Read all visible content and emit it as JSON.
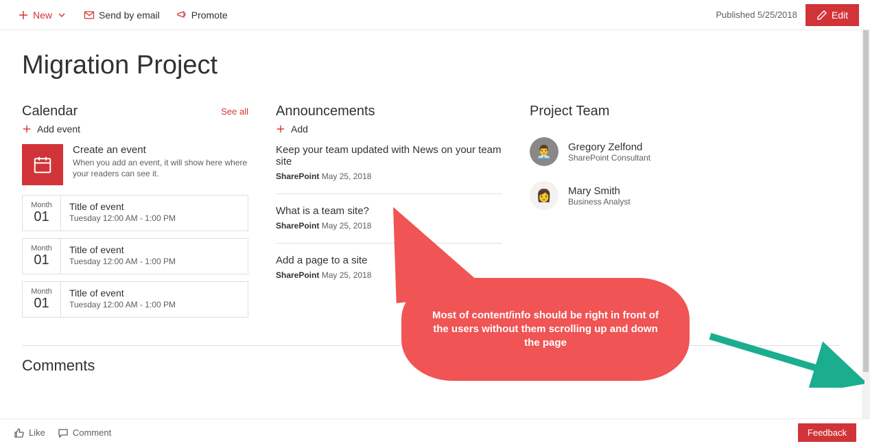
{
  "toolbar": {
    "new_label": "New",
    "send_label": "Send by email",
    "promote_label": "Promote",
    "published_label": "Published 5/25/2018",
    "edit_label": "Edit"
  },
  "page": {
    "title": "Migration Project"
  },
  "calendar": {
    "heading": "Calendar",
    "see_all": "See all",
    "add_label": "Add event",
    "hero_title": "Create an event",
    "hero_sub": "When you add an event, it will show here where your readers can see it.",
    "events": [
      {
        "month": "Month",
        "day": "01",
        "title": "Title of event",
        "time": "Tuesday 12:00 AM - 1:00 PM"
      },
      {
        "month": "Month",
        "day": "01",
        "title": "Title of event",
        "time": "Tuesday 12:00 AM - 1:00 PM"
      },
      {
        "month": "Month",
        "day": "01",
        "title": "Title of event",
        "time": "Tuesday 12:00 AM - 1:00 PM"
      }
    ]
  },
  "announcements": {
    "heading": "Announcements",
    "add_label": "Add",
    "items": [
      {
        "title": "Keep your team updated with News on your team site",
        "source": "SharePoint",
        "date": "May 25, 2018"
      },
      {
        "title": "What is a team site?",
        "source": "SharePoint",
        "date": "May 25, 2018"
      },
      {
        "title": "Add a page to a site",
        "source": "SharePoint",
        "date": "May 25, 2018"
      }
    ]
  },
  "team": {
    "heading": "Project Team",
    "members": [
      {
        "name": "Gregory Zelfond",
        "role": "SharePoint Consultant",
        "avatar_bg": "#8a8886",
        "avatar_emoji": "👨‍💼"
      },
      {
        "name": "Mary Smith",
        "role": "Business Analyst",
        "avatar_bg": "#f3f2f1",
        "avatar_emoji": "👩"
      }
    ]
  },
  "comments": {
    "heading": "Comments"
  },
  "bottom": {
    "like": "Like",
    "comment": "Comment",
    "feedback": "Feedback"
  },
  "callout": {
    "text": "Most of content/info should be right in front of the users without them scrolling up and down the page"
  }
}
